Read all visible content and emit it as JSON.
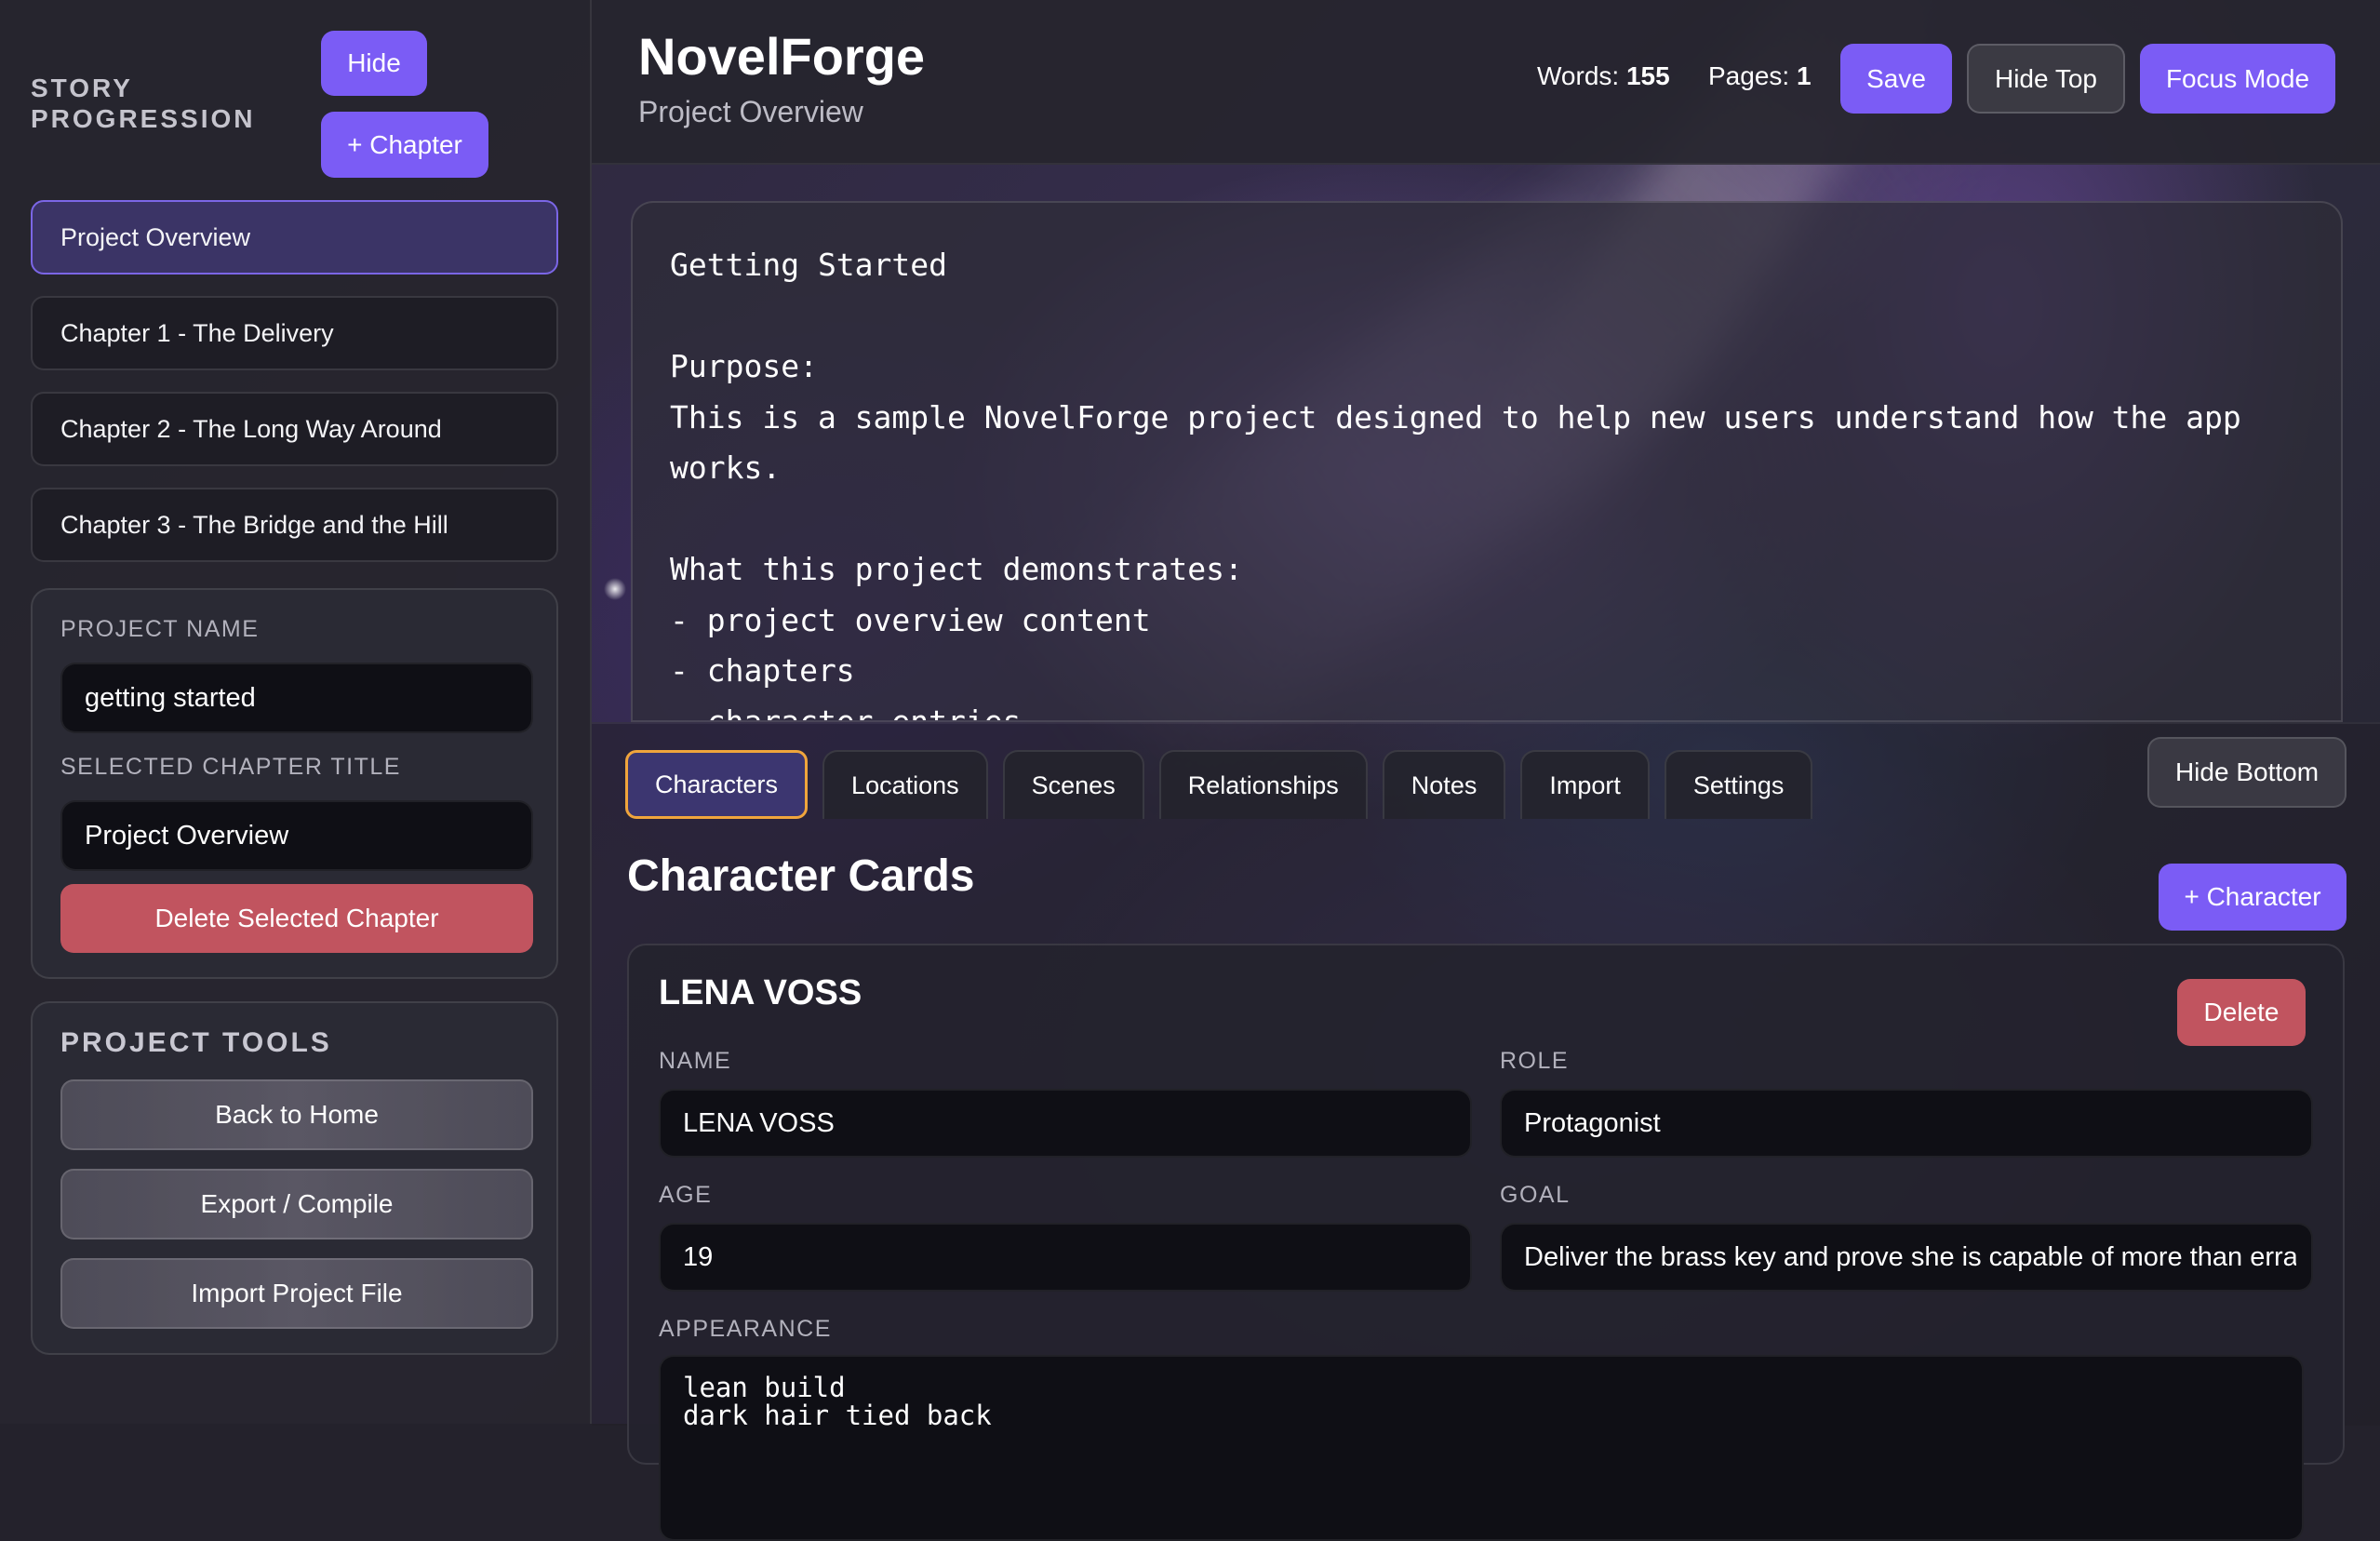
{
  "sidebar": {
    "heading": "STORY PROGRESSION",
    "hide_label": "Hide",
    "add_chapter_label": "+ Chapter",
    "chapters": [
      {
        "label": "Project Overview",
        "active": true
      },
      {
        "label": "Chapter 1 - The Delivery"
      },
      {
        "label": "Chapter 2 - The Long Way Around"
      },
      {
        "label": "Chapter 3 - The Bridge and the Hill"
      }
    ],
    "project": {
      "name_label": "PROJECT NAME",
      "name_value": "getting started",
      "chapter_title_label": "SELECTED CHAPTER TITLE",
      "chapter_title_value": "Project Overview",
      "delete_label": "Delete Selected Chapter"
    },
    "tools": {
      "title": "PROJECT TOOLS",
      "back_label": "Back to Home",
      "export_label": "Export / Compile",
      "import_label": "Import Project File"
    }
  },
  "header": {
    "title": "NovelForge",
    "subtitle": "Project Overview",
    "words_label": "Words:",
    "words_value": "155",
    "pages_label": "Pages:",
    "pages_value": "1",
    "save_label": "Save",
    "hide_top_label": "Hide Top",
    "focus_label": "Focus Mode"
  },
  "editor": {
    "text": "Getting Started\n\nPurpose:\nThis is a sample NovelForge project designed to help new users understand how the app works.\n\nWhat this project demonstrates:\n- project overview content\n- chapters\n- character entries"
  },
  "bottom": {
    "tabs": [
      "Characters",
      "Locations",
      "Scenes",
      "Relationships",
      "Notes",
      "Import",
      "Settings"
    ],
    "active_tab": "Characters",
    "hide_bottom_label": "Hide Bottom",
    "section_title": "Character Cards",
    "add_character_label": "+ Character",
    "character": {
      "heading": "LENA VOSS",
      "delete_label": "Delete",
      "name_label": "NAME",
      "name_value": "LENA VOSS",
      "role_label": "ROLE",
      "role_value": "Protagonist",
      "age_label": "AGE",
      "age_value": "19",
      "goal_label": "GOAL",
      "goal_value": "Deliver the brass key and prove she is capable of more than errands",
      "appearance_label": "APPEARANCE",
      "appearance_value": "lean build\ndark hair tied back"
    }
  },
  "colors": {
    "accent": "#7b5cf5",
    "danger": "#c1545f",
    "active_tab_border": "#f0a53c"
  }
}
